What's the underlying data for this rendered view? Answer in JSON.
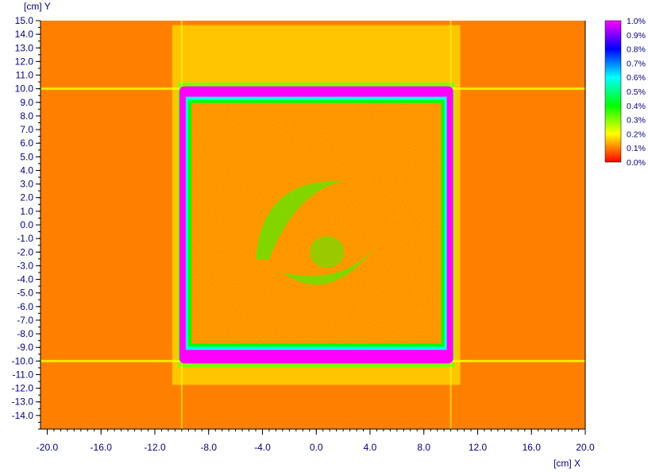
{
  "chart_data": {
    "type": "heatmap",
    "title": "",
    "xlabel": "[cm] X",
    "ylabel": "[cm] Y",
    "xlim": [
      -20.5,
      20.0
    ],
    "ylim": [
      -15.0,
      15.0
    ],
    "x_ticks": [
      -20.0,
      -16.0,
      -12.0,
      -8.0,
      -4.0,
      0.0,
      4.0,
      8.0,
      12.0,
      16.0,
      20.0
    ],
    "x_tick_labels": [
      "-20.0",
      "-16.0",
      "-12.0",
      "-8.0",
      "-4.0",
      "0.0",
      "4.0",
      "8.0",
      "12.0",
      "16.0",
      "20.0"
    ],
    "y_ticks": [
      15.0,
      14.0,
      13.0,
      12.0,
      11.0,
      10.0,
      9.0,
      8.0,
      7.0,
      6.0,
      5.0,
      4.0,
      3.0,
      2.0,
      1.0,
      0.0,
      -1.0,
      -2.0,
      -3.0,
      -4.0,
      -5.0,
      -6.0,
      -7.0,
      -8.0,
      -9.0,
      -10.0,
      -11.0,
      -12.0,
      -13.0,
      -14.0
    ],
    "y_tick_labels": [
      "15.0",
      "14.0",
      "13.0",
      "12.0",
      "11.0",
      "10.0",
      "9.0",
      "8.0",
      "7.0",
      "6.0",
      "5.0",
      "4.0",
      "3.0",
      "2.0",
      "1.0",
      "0.0",
      "-1.0",
      "-2.0",
      "-3.0",
      "-4.0",
      "-5.0",
      "-6.0",
      "-7.0",
      "-8.0",
      "-9.0",
      "-10.0",
      "-11.0",
      "-12.0",
      "-13.0",
      "-14.0"
    ],
    "colorscale": {
      "range": [
        0.0,
        1.0
      ],
      "unit": "%",
      "labels": [
        "1.0%",
        "0.9%",
        "0.8%",
        "0.7%",
        "0.6%",
        "0.5%",
        "0.4%",
        "0.3%",
        "0.2%",
        "0.1%",
        "0.0%"
      ],
      "colors": [
        "#ff00ff",
        "#8000ff",
        "#0000ff",
        "#0080ff",
        "#00ffff",
        "#00ff80",
        "#00ff00",
        "#80ff00",
        "#ffff00",
        "#ff8000",
        "#ff0000"
      ],
      "placement": "right"
    },
    "field_square": {
      "x_range": [
        -10.0,
        10.0
      ],
      "y_range": [
        -10.0,
        10.0
      ],
      "edge_value": 1.0
    },
    "outside_value": 0.05,
    "inside_value": 0.1,
    "swirl_value": 0.35
  }
}
